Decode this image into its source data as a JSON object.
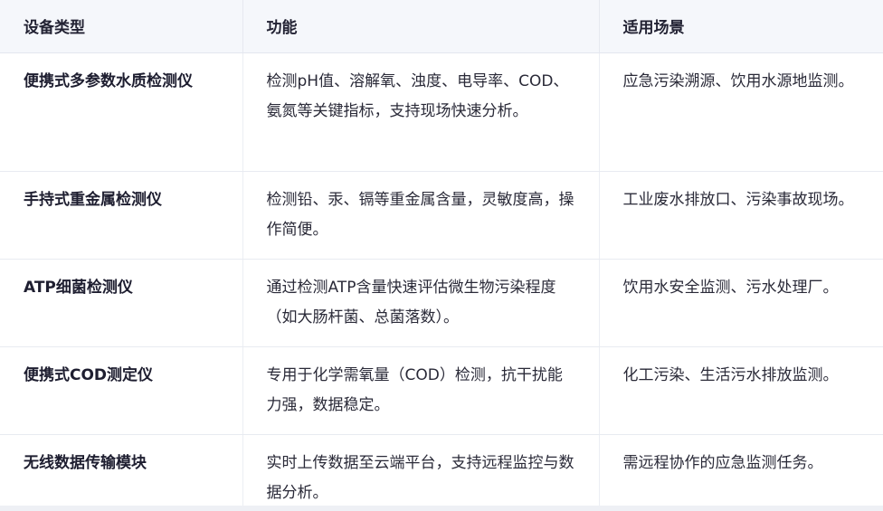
{
  "table": {
    "headers": [
      "设备类型",
      "功能",
      "适用场景"
    ],
    "rows": [
      {
        "device": "便携式多参数水质检测仪",
        "function": "检测pH值、溶解氧、浊度、电导率、COD、氨氮等关键指标，支持现场快速分析。",
        "scenario": "应急污染溯源、饮用水源地监测。"
      },
      {
        "device": "手持式重金属检测仪",
        "function": "检测铅、汞、镉等重金属含量，灵敏度高，操作简便。",
        "scenario": "工业废水排放口、污染事故现场。"
      },
      {
        "device": "ATP细菌检测仪",
        "function": "通过检测ATP含量快速评估微生物污染程度（如大肠杆菌、总菌落数）。",
        "scenario": "饮用水安全监测、污水处理厂。"
      },
      {
        "device": "便携式COD测定仪",
        "function": "专用于化学需氧量（COD）检测，抗干扰能力强，数据稳定。",
        "scenario": "化工污染、生活污水排放监测。"
      },
      {
        "device": "无线数据传输模块",
        "function": "实时上传数据至云端平台，支持远程监控与数据分析。",
        "scenario": "需远程协作的应急监测任务。"
      }
    ]
  }
}
